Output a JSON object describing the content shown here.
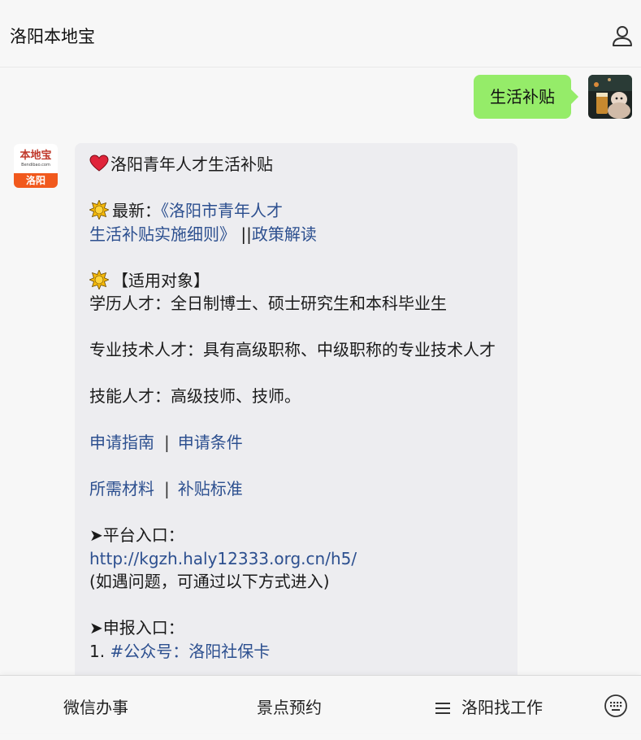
{
  "header": {
    "title": "洛阳本地宝",
    "user_icon": "user-icon"
  },
  "outgoing": {
    "text": "生活补贴"
  },
  "bot": {
    "avatar_logo": "本地宝",
    "avatar_url": "Bendibao.com",
    "avatar_city": "洛阳"
  },
  "card": {
    "title": "洛阳青年人才生活补贴",
    "latest_label": "最新：",
    "latest_link_1": "《洛阳市青年人才",
    "latest_link_2": "生活补贴实施细则》",
    "latest_sep": " ||",
    "policy_link": "政策解读",
    "target_heading": "【适用对象】",
    "target_1": "学历人才：全日制博士、硕士研究生和本科毕业生",
    "target_2": "专业技术人才：具有高级职称、中级职称的专业技术人才",
    "target_3": "技能人才：高级技师、技师。",
    "link_guide": "申请指南",
    "link_conditions": "申请条件",
    "link_materials": "所需材料",
    "link_standard": "补贴标准",
    "separator": "|",
    "platform_label": "➤平台入口：",
    "platform_url": "http://kgzh.haly12333.org.cn/h5/",
    "platform_note": "(如遇问题，可通过以下方式进入)",
    "apply_label": "➤申报入口：",
    "apply_1_num": "1.",
    "apply_1_link": "#公众号：洛阳社保卡"
  },
  "bottom_menu": {
    "item_1": "微信办事",
    "item_2": "景点预约",
    "item_3": "洛阳找工作",
    "item_3_icon": "menu-lines-icon",
    "keyboard_icon": "keyboard-icon"
  },
  "colors": {
    "outgoing_bubble": "#95ec69",
    "link": "#2c4f8f",
    "incoming_bubble": "#ededf0",
    "brand_orange": "#f1591d"
  }
}
